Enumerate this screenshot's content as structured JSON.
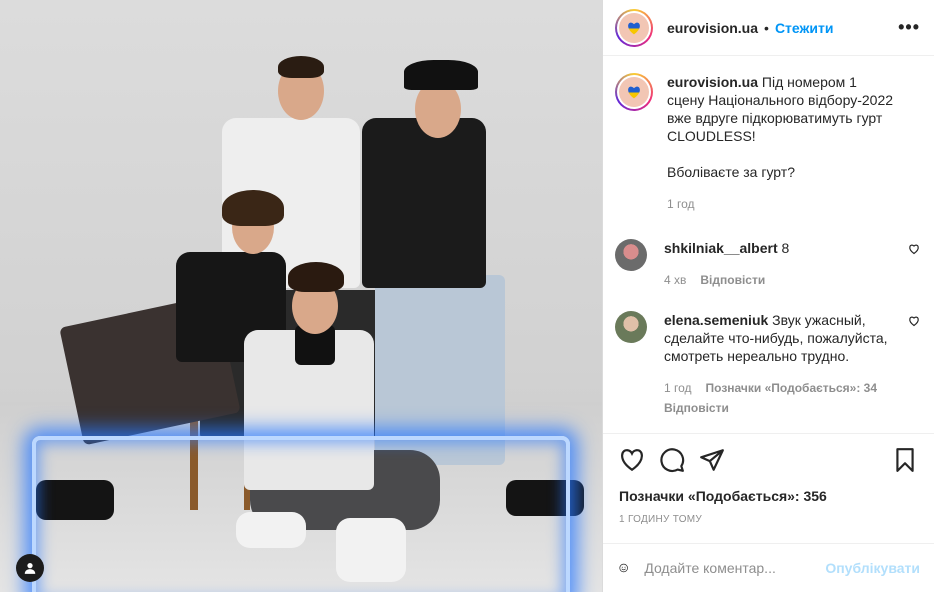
{
  "post": {
    "username": "eurovision.ua",
    "follow_label": "Стежити",
    "separator": "•",
    "more_label": "•••"
  },
  "caption": {
    "username": "eurovision.ua",
    "text_line1": "Під номером 1 сцену Національного відбору-2022 вже вдруге підкорюватимуть гурт CLOUDLESS!",
    "text_line2": "Вболіваєте за гурт?",
    "time": "1 год"
  },
  "comments": [
    {
      "username": "shkilniak__albert",
      "text": "8",
      "time": "4 хв",
      "reply_label": "Відповісти",
      "likes_label": ""
    },
    {
      "username": "elena.semeniuk",
      "text": "Звук ужасный, сделайте что-нибудь, пожалуйста, смотреть нереально трудно.",
      "time": "1 год",
      "likes_label": "Позначки «Подобається»: 34",
      "reply_label": "Відповісти"
    }
  ],
  "actions": {
    "likes_text": "Позначки «Подобається»: 356",
    "timestamp": "1 годину тому"
  },
  "add_comment": {
    "placeholder": "Додайте коментар...",
    "post_label": "Опублікувати"
  },
  "colors": {
    "accent": "#0095f6",
    "glow": "#2878ff"
  },
  "icons": {
    "like": "heart-icon",
    "comment": "comment-icon",
    "share": "paper-plane-icon",
    "save": "bookmark-icon",
    "emoji": "smiley-icon",
    "tag": "user-tag-icon",
    "more": "ellipsis-icon"
  }
}
